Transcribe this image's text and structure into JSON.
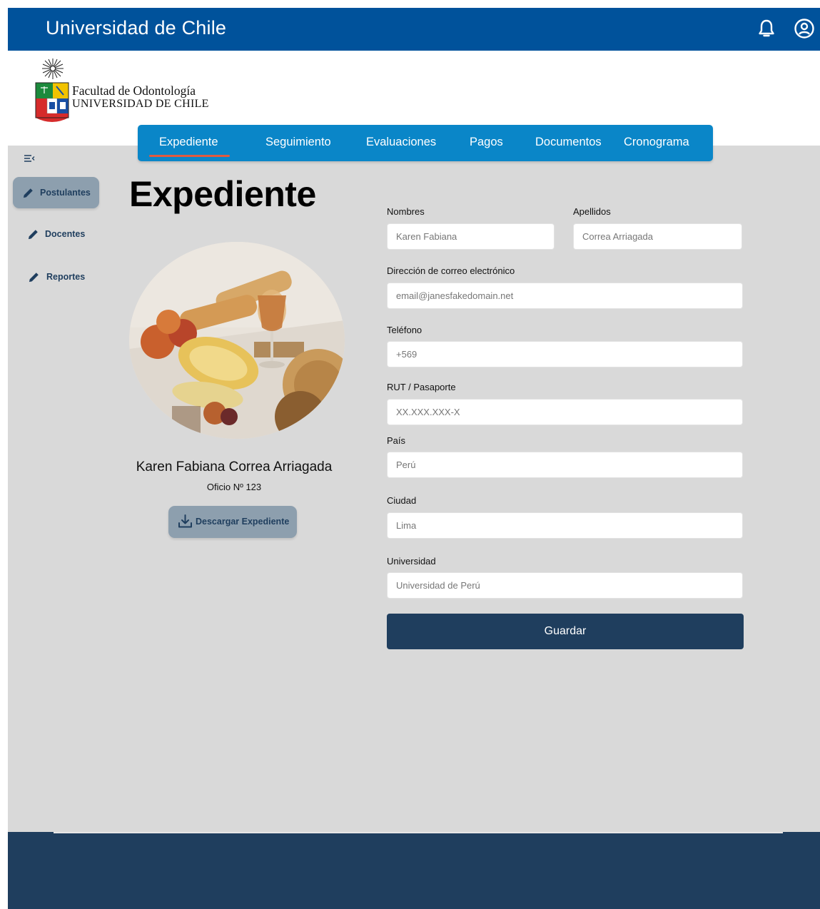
{
  "header": {
    "title": "Universidad de Chile",
    "icons": [
      "bell-icon",
      "user-circle-icon"
    ],
    "color": "#00529b"
  },
  "logo": {
    "line1": "Facultad de Odontología",
    "line2": "UNIVERSIDAD DE CHILE"
  },
  "tabs": [
    {
      "label": "Expediente",
      "active": true
    },
    {
      "label": "Seguimiento"
    },
    {
      "label": "Evaluaciones"
    },
    {
      "label": "Pagos"
    },
    {
      "label": "Documentos"
    },
    {
      "label": "Cronograma"
    }
  ],
  "sidebar": {
    "collapse_icon": "collapse-menu-icon",
    "items": [
      {
        "label": "Postulantes",
        "icon": "pencil-icon",
        "active": true
      },
      {
        "label": "Docentes",
        "icon": "pencil-icon"
      },
      {
        "label": "Reportes",
        "icon": "pencil-icon"
      }
    ]
  },
  "profile": {
    "page_title": "Expediente",
    "name": "Karen Fabiana Correa Arriagada",
    "office": "Oficio Nº 123",
    "download_label": "Descargar Expediente",
    "download_icon": "download-icon"
  },
  "form": {
    "nombres": {
      "label": "Nombres",
      "placeholder": "Karen Fabiana"
    },
    "apellidos": {
      "label": "Apellidos",
      "placeholder": "Correa Arriagada"
    },
    "email": {
      "label": "Dirección de correo electrónico",
      "placeholder": "email@janesfakedomain.net"
    },
    "telefono": {
      "label": "Teléfono",
      "placeholder": "+569"
    },
    "rut": {
      "label": "RUT / Pasaporte",
      "placeholder": "XX.XXX.XXX-X"
    },
    "pais": {
      "label": "País",
      "placeholder": "Perú"
    },
    "ciudad": {
      "label": "Ciudad",
      "placeholder": "Lima"
    },
    "universidad": {
      "label": "Universidad",
      "placeholder": "Universidad de Perú"
    },
    "save_label": "Guardar"
  },
  "colors": {
    "tab_bar": "#0a86c8",
    "tab_underline": "#e05a3f",
    "primary_dark": "#1f3e5e",
    "sidebar_active": "#8d9fae",
    "background": "#d9d9d9"
  }
}
